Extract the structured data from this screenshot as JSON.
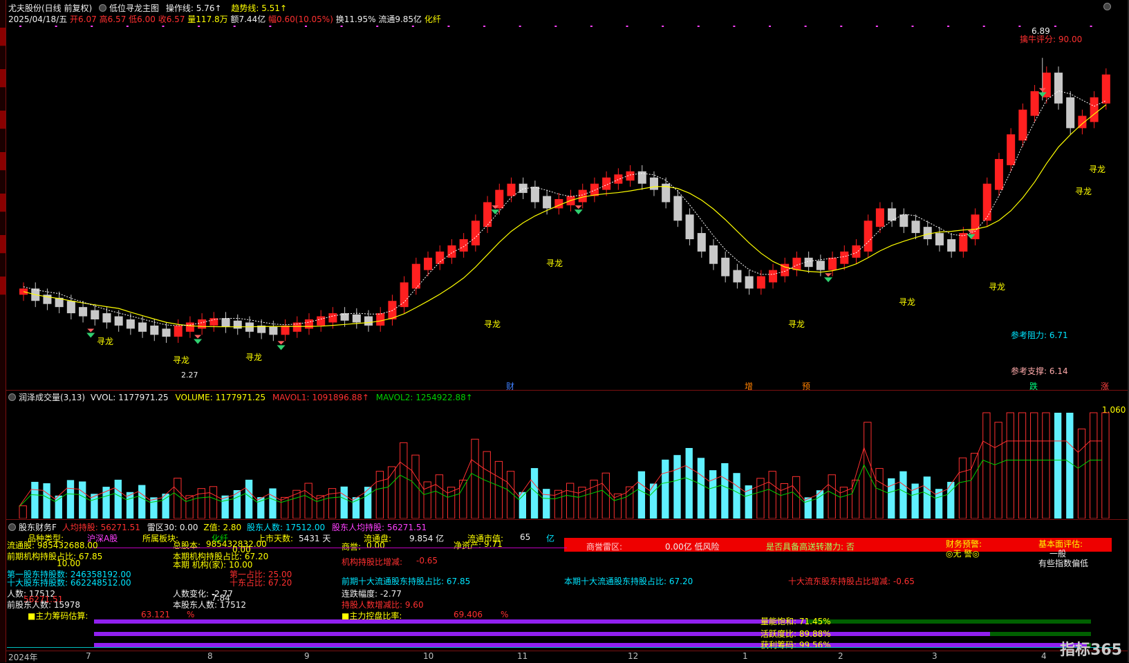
{
  "header": {
    "stock": "尤夫股份(日线 前复权)",
    "indicator": "低位寻龙主图",
    "op_line_label": "操作线:",
    "op_line_value": "5.76↑",
    "trend_label": "趋势线:",
    "trend_value": "5.51↑"
  },
  "quote": {
    "date": "2025/04/18/五",
    "open": "开6.07",
    "high": "高6.57",
    "low": "低6.00",
    "close": "收6.57",
    "volume": "量117.8万",
    "amount": "额7.44亿",
    "change": "幅0.60(10.05%)",
    "turnover": "换11.95%",
    "float": "流通9.85亿",
    "sector": "化纤"
  },
  "main_chart": {
    "score": "擒牛评分: 90.00",
    "peak": "6.89",
    "resistance": "参考阻力: 6.71",
    "support": "参考支撑: 6.14",
    "low_mark": "2.27",
    "xunlong": "寻龙",
    "events": [
      {
        "text": "财",
        "color": "#4080ff"
      },
      {
        "text": "增",
        "color": "#ff8000"
      },
      {
        "text": "预",
        "color": "#ff8000"
      },
      {
        "text": "跌",
        "color": "#00ff80"
      },
      {
        "text": "涨",
        "color": "#ff4040"
      }
    ],
    "candles": [
      3.1,
      3.0,
      2.95,
      2.9,
      2.8,
      2.75,
      2.7,
      2.65,
      2.6,
      2.55,
      2.5,
      2.45,
      2.42,
      2.5,
      2.55,
      2.6,
      2.62,
      2.58,
      2.55,
      2.5,
      2.48,
      2.45,
      2.5,
      2.55,
      2.6,
      2.65,
      2.7,
      2.68,
      2.65,
      2.6,
      2.7,
      2.9,
      3.2,
      3.5,
      3.6,
      3.7,
      3.8,
      3.9,
      4.2,
      4.5,
      4.7,
      4.8,
      4.75,
      4.6,
      4.5,
      4.55,
      4.6,
      4.7,
      4.8,
      4.9,
      4.95,
      5.0,
      4.9,
      4.8,
      4.6,
      4.3,
      4.0,
      3.8,
      3.6,
      3.4,
      3.3,
      3.2,
      3.3,
      3.4,
      3.5,
      3.6,
      3.55,
      3.5,
      3.6,
      3.7,
      3.8,
      4.2,
      4.4,
      4.3,
      4.2,
      4.1,
      4.0,
      3.9,
      3.8,
      4.0,
      4.3,
      4.8,
      5.2,
      5.6,
      6.0,
      6.3,
      6.6,
      6.2,
      5.8,
      5.9,
      6.2,
      6.57
    ],
    "y_range": [
      2.0,
      7.2
    ]
  },
  "volume_panel": {
    "title": "润泽成交量(3,13)",
    "vvol": "VVOL: 1177971.25",
    "volume": "VOLUME: 1177971.25",
    "mavol1": "MAVOL1: 1091896.88↑",
    "mavol2": "MAVOL2: 1254922.88↑",
    "right_value": "1.060"
  },
  "finance_panel": {
    "title": "股东财务F",
    "avg_hold": "人均持股: 56271.51",
    "lei": "雷区30: 0.00",
    "z": "Z值: 2.80",
    "holders": "股东人数: 17512.00",
    "holders_avg": "股东人均持股: 56271.51",
    "rows": {
      "cat_label": "品种类型:",
      "cat_value": "沪深A股",
      "sector_label": "所属板块:",
      "sector_value": "化纤",
      "capital_label": "总股本:",
      "capital_value": "985432832.00",
      "days_label": "上市天数:",
      "days_value": "5431 天",
      "float_label": "流通盘:",
      "float_value": "9.854 亿",
      "mcap_label": "流通市值:",
      "mcap_value": "65",
      "mcap_unit": "亿",
      "assets_label": "净资产:",
      "assets_value": "9.71",
      "goodwill_label": "商誉:",
      "goodwill_value": "0.00",
      "inst_label": "机构持股比增减:",
      "inst_value": "-0.65",
      "float_shares": "流通股: 985432688.00",
      "prev_inst": "前期机构持股占比: 67.85",
      "cur_inst": "本期机构持股占比: 67.20",
      "zero1": "0.00",
      "zero2": "10.00",
      "cur_inst2": "本期 机构(家): 10.00",
      "prev_top10": "前期十大流通股东持股占比: 67.85",
      "cur_top10": "本期十大流通股东持股占比: 67.20",
      "top10_change": "十大流东股东持股占比增减: -0.65",
      "first_holder": "第一股东持股数: 246358192.00",
      "top10_holder": "十大股东持股数: 662248512.00",
      "first_ratio": "第一占比: 25.00",
      "top_ratio": "十东占比: 67.20",
      "people": "人数: 17512",
      "people_change": "人数变化: -2.77",
      "decline": "连跌幅度: -2.77",
      "prev_holders": "前股东人数: 15978",
      "cur_holders": "本股东人数: 17512",
      "avg_change": "持股人数增减比: 9.60",
      "red_value": "56271.51",
      "mid_value": "7.84"
    },
    "chip_label": "■主力筹码估算:",
    "chip_value": "63.121",
    "chip_unit": "%",
    "ctrl_label": "■主力控盘比率:",
    "ctrl_value": "69.406",
    "ctrl_unit": "%",
    "risk": {
      "lei_label": "商誉雷区:",
      "lei_value": "0.00亿 低风险",
      "send_label": "是否具备高送转潜力: 否",
      "warn_label": "财务预警:",
      "warn_value": "◎无 警◎",
      "eval_label": "基本面评估:",
      "eval_value1": "一般",
      "eval_value2": "有些指数偏低"
    },
    "bars": {
      "sat": "量能饱和: 71.45%",
      "act": "活跃度比: 89.88%",
      "profit": "获利筹码: 99.56%",
      "sat_pct": 71.45,
      "act_pct": 89.88,
      "profit_pct": 99.56
    }
  },
  "x_axis": [
    "2024年",
    "7",
    "8",
    "9",
    "10",
    "11",
    "12",
    "1",
    "2",
    "3",
    "4"
  ],
  "brand": "指标365",
  "colors": {
    "up": "#ff2020",
    "down": "#c8c8c8",
    "trend": "#ffff00",
    "ma": "#ffffff"
  }
}
